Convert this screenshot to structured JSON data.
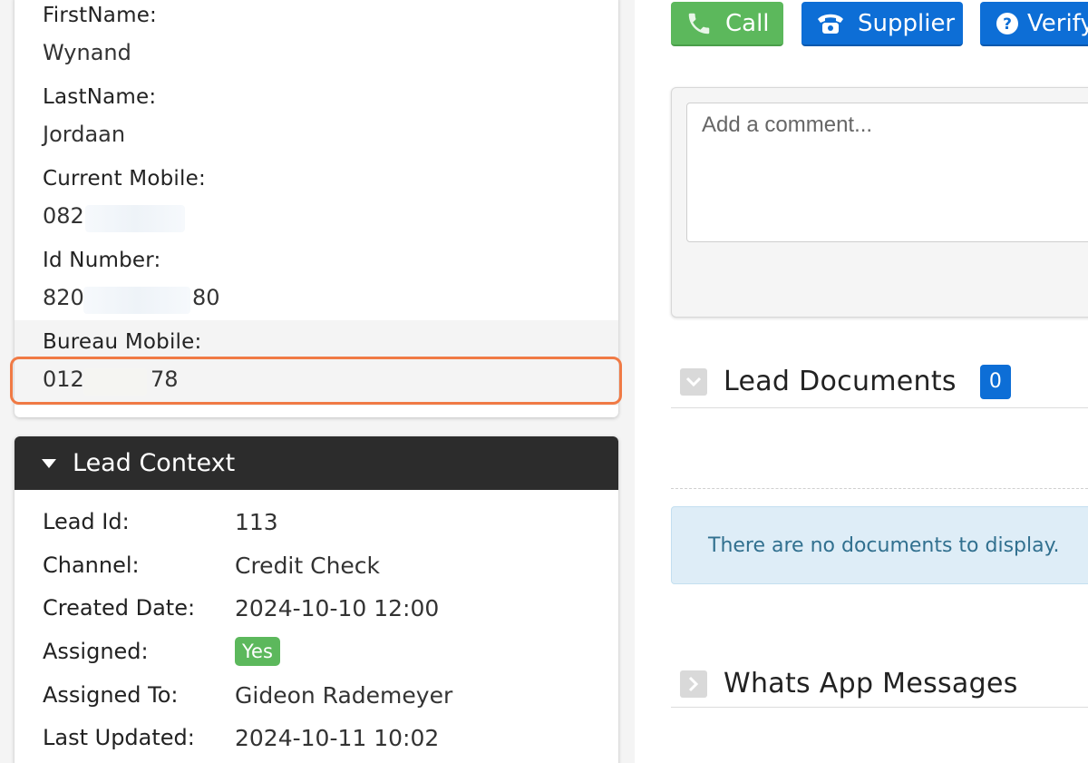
{
  "contact": {
    "first_name_label": "FirstName:",
    "first_name": "Wynand",
    "last_name_label": "LastName:",
    "last_name": "Jordaan",
    "current_mobile_label": "Current Mobile:",
    "current_mobile": "082",
    "id_number_label": "Id Number:",
    "id_number_start": "820",
    "id_number_end": "80",
    "bureau_mobile_label": "Bureau Mobile:",
    "bureau_mobile_start": "012",
    "bureau_mobile_end": "78"
  },
  "lead_context": {
    "title": "Lead Context",
    "rows": [
      {
        "label": "Lead Id:",
        "value": "113"
      },
      {
        "label": "Channel:",
        "value": "Credit Check"
      },
      {
        "label": "Created Date:",
        "value": "2024-10-10 12:00"
      },
      {
        "label": "Assigned:",
        "value": "Yes"
      },
      {
        "label": "Assigned To:",
        "value": "Gideon Rademeyer"
      },
      {
        "label": "Last Updated:",
        "value": "2024-10-11 10:02"
      }
    ]
  },
  "actions": {
    "call_label": "Call",
    "supplier_label": "Supplier",
    "verify_label": "Verify"
  },
  "comment": {
    "placeholder": "Add a comment..."
  },
  "lead_documents": {
    "title": "Lead Documents",
    "count": "0",
    "empty_message": "There are no documents to display."
  },
  "whatsapp": {
    "title": "Whats App Messages"
  },
  "colors": {
    "highlight": "#f07a45",
    "success": "#5cb85c",
    "primary": "#0d6ed6",
    "header_dark": "#2c2c2c",
    "info_bg": "#deedf7"
  }
}
